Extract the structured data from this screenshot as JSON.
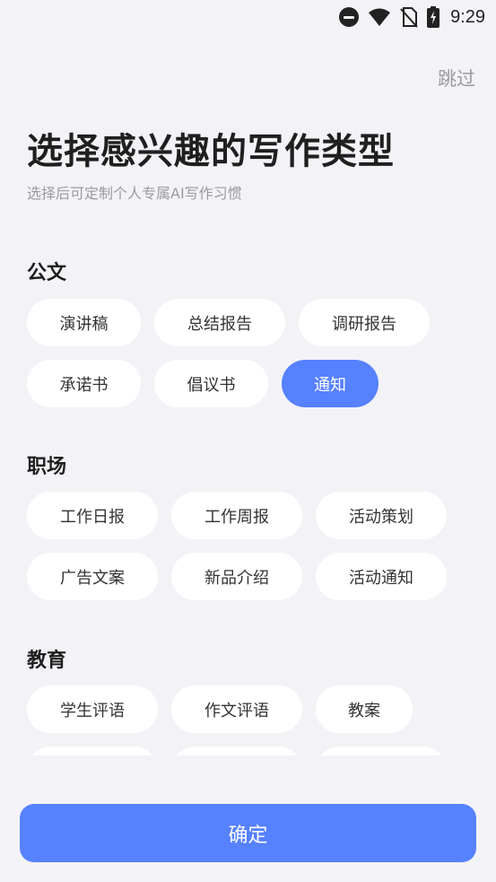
{
  "status_bar": {
    "time": "9:29",
    "icons": [
      "do-not-disturb-icon",
      "wifi-icon",
      "no-sim-icon",
      "battery-charging-icon"
    ]
  },
  "header": {
    "skip_label": "跳过",
    "title": "选择感兴趣的写作类型",
    "subtitle": "选择后可定制个人专属AI写作习惯"
  },
  "sections": [
    {
      "title": "公文",
      "chips": [
        {
          "label": "演讲稿",
          "selected": false
        },
        {
          "label": "总结报告",
          "selected": false
        },
        {
          "label": "调研报告",
          "selected": false
        },
        {
          "label": "承诺书",
          "selected": false
        },
        {
          "label": "倡议书",
          "selected": false
        },
        {
          "label": "通知",
          "selected": true
        }
      ]
    },
    {
      "title": "职场",
      "chips": [
        {
          "label": "工作日报",
          "selected": false
        },
        {
          "label": "工作周报",
          "selected": false
        },
        {
          "label": "活动策划",
          "selected": false
        },
        {
          "label": "广告文案",
          "selected": false
        },
        {
          "label": "新品介绍",
          "selected": false
        },
        {
          "label": "活动通知",
          "selected": false
        }
      ]
    },
    {
      "title": "教育",
      "chips": [
        {
          "label": "学生评语",
          "selected": false
        },
        {
          "label": "作文评语",
          "selected": false
        },
        {
          "label": "教案",
          "selected": false
        },
        {
          "label": "",
          "selected": false
        },
        {
          "label": "",
          "selected": false
        },
        {
          "label": "",
          "selected": false
        }
      ]
    }
  ],
  "colors": {
    "accent": "#5681ff",
    "background": "#f3f3f7",
    "chip": "#ffffff"
  },
  "footer": {
    "confirm_label": "确定"
  }
}
